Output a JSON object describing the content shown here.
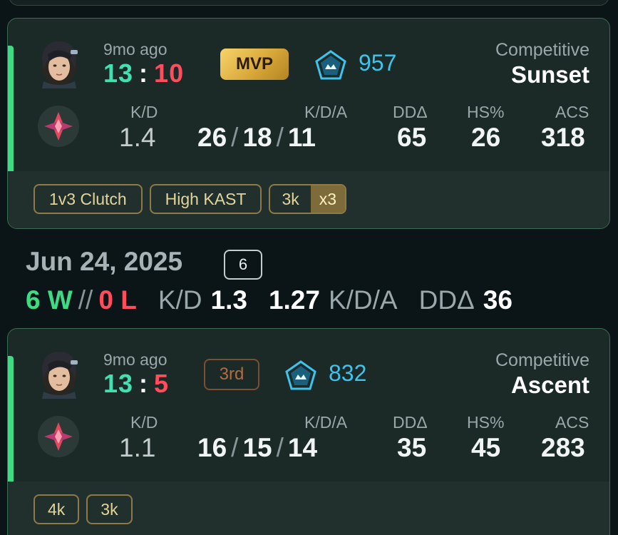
{
  "colors": {
    "win": "#3ddc84",
    "loss": "#ff4d5e",
    "rr": "#3cc3ee",
    "mvp_gold": "#e0b247",
    "tag_border": "#8d7a46"
  },
  "matches": [
    {
      "agent_icon": "agent-portrait-icon",
      "rank_icon": "rank-diamond-icon",
      "time_ago": "9mo ago",
      "score_won": "13",
      "score_sep": ":",
      "score_lost": "10",
      "badge": "MVP",
      "rr_icon": "rank-pentagon-icon",
      "rr_value": "957",
      "mode": "Competitive",
      "map": "Sunset",
      "labels": {
        "kd": "K/D",
        "kda": "K/D/A",
        "dda": "DDΔ",
        "hs": "HS%",
        "acs": "ACS"
      },
      "kd": "1.4",
      "kills": "26",
      "deaths": "18",
      "assists": "11",
      "slash": "/",
      "dda": "65",
      "hs": "26",
      "acs": "318",
      "tags": [
        "1v3 Clutch",
        "High KAST"
      ],
      "multi_tag": {
        "label": "3k",
        "count": "x3"
      }
    },
    {
      "agent_icon": "agent-portrait-icon",
      "rank_icon": "rank-diamond-icon",
      "time_ago": "9mo ago",
      "score_won": "13",
      "score_sep": ":",
      "score_lost": "5",
      "badge": "3rd",
      "rr_icon": "rank-pentagon-icon",
      "rr_value": "832",
      "mode": "Competitive",
      "map": "Ascent",
      "labels": {
        "kd": "K/D",
        "kda": "K/D/A",
        "dda": "DDΔ",
        "hs": "HS%",
        "acs": "ACS"
      },
      "kd": "1.1",
      "kills": "16",
      "deaths": "15",
      "assists": "14",
      "slash": "/",
      "dda": "35",
      "hs": "45",
      "acs": "283",
      "tags": [
        "4k",
        "3k"
      ]
    }
  ],
  "day": {
    "date": "Jun 24, 2025",
    "match_count": "6",
    "wins": "6 W",
    "sep": "//",
    "losses": "0 L",
    "kd_label": "K/D",
    "kd_value": "1.3",
    "kda_value": "1.27",
    "kda_label": "K/D/A",
    "dda_label": "DDΔ",
    "dda_value": "36"
  }
}
